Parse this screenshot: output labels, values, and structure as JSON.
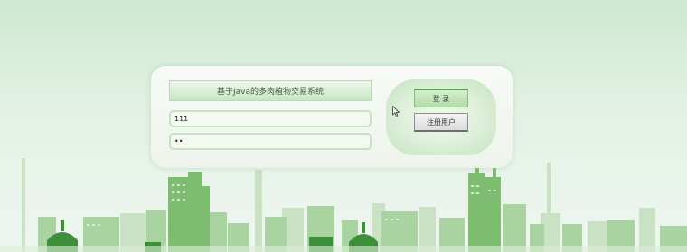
{
  "login": {
    "title": "基于Java的多肉植物交易系统",
    "username_value": "111",
    "password_value": "••",
    "login_button": "登 录",
    "register_button": "注册用户"
  },
  "colors": {
    "accent_green": "#b2dba6",
    "accent_border": "#5a9d55",
    "background": "#dff0e1"
  },
  "icons": [
    "mouse-pointer-icon"
  ]
}
